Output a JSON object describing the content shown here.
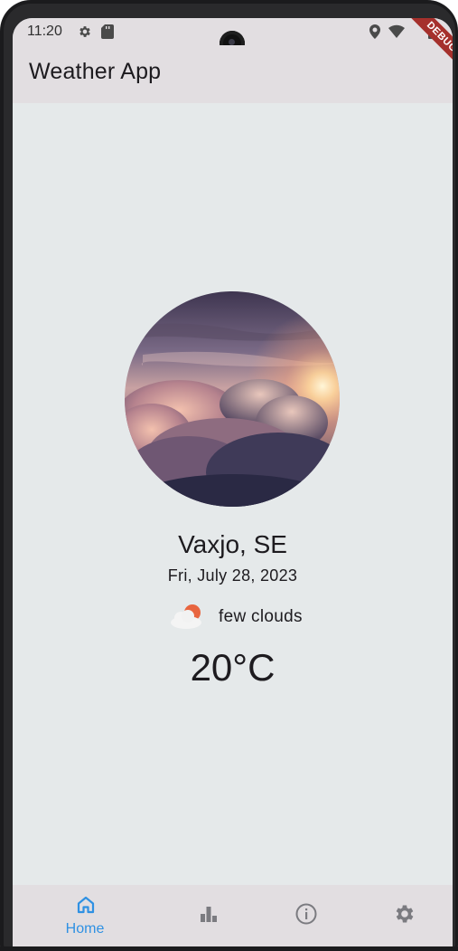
{
  "status_bar": {
    "time": "11:20",
    "left_icons": [
      "gear-icon",
      "sd-card-icon"
    ],
    "right_icons": [
      "location-pin-icon",
      "wifi-icon",
      "battery-icon"
    ]
  },
  "debug_banner": {
    "label": "DEBUG"
  },
  "app_bar": {
    "title": "Weather App"
  },
  "weather": {
    "image": "clouds-sunset-photo",
    "city": "Vaxjo, SE",
    "date": "Fri, July 28, 2023",
    "condition_icon": "few-clouds-icon",
    "condition": "few clouds",
    "temperature": "20°C"
  },
  "bottom_nav": {
    "items": [
      {
        "icon": "home-icon",
        "label": "Home",
        "active": true
      },
      {
        "icon": "bar-chart-icon",
        "label": "",
        "active": false
      },
      {
        "icon": "info-icon",
        "label": "",
        "active": false
      },
      {
        "icon": "settings-icon",
        "label": "",
        "active": false
      }
    ]
  },
  "colors": {
    "accent": "#2f91e3",
    "inactive_icon": "#7b7b80",
    "screen_background": "#e5e9ea",
    "bar_background": "#e2dee1",
    "debug_banner": "#a5302c"
  }
}
